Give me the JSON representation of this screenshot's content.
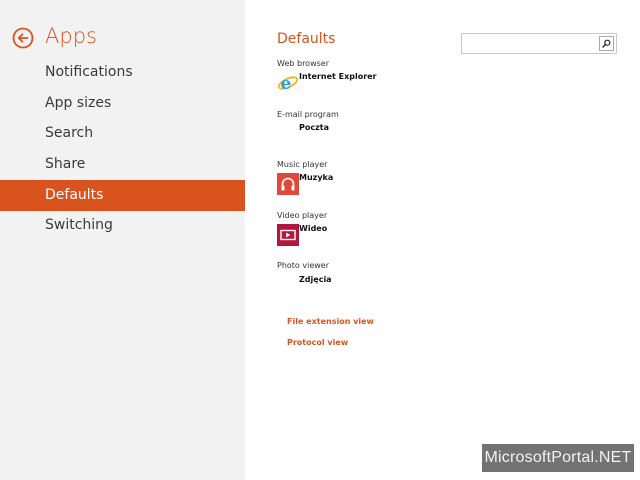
{
  "colors": {
    "accent": "#d9531e",
    "sidebar_bg": "#f2f2f2"
  },
  "sidebar": {
    "title": "Apps",
    "back_icon": "back-arrow-circle-icon",
    "items": [
      {
        "label": "Notifications"
      },
      {
        "label": "App sizes"
      },
      {
        "label": "Search"
      },
      {
        "label": "Share"
      },
      {
        "label": "Defaults",
        "selected": true
      },
      {
        "label": "Switching"
      }
    ]
  },
  "main": {
    "title": "Defaults",
    "search": {
      "placeholder": "",
      "icon": "search-icon"
    },
    "defaults": [
      {
        "category": "Web browser",
        "app": "Internet Explorer",
        "icon": "internet-explorer-icon"
      },
      {
        "category": "E-mail program",
        "app": "Poczta",
        "icon": ""
      },
      {
        "category": "Music player",
        "app": "Muzyka",
        "icon": "headphones-icon",
        "icon_color": "#e0483b"
      },
      {
        "category": "Video player",
        "app": "Wideo",
        "icon": "video-icon",
        "icon_color": "#b0173f"
      },
      {
        "category": "Photo viewer",
        "app": "Zdjęcia",
        "icon": ""
      }
    ],
    "links": [
      {
        "label": "File extension view"
      },
      {
        "label": "Protocol view"
      }
    ]
  },
  "watermark": "MicrosoftPortal.NET"
}
